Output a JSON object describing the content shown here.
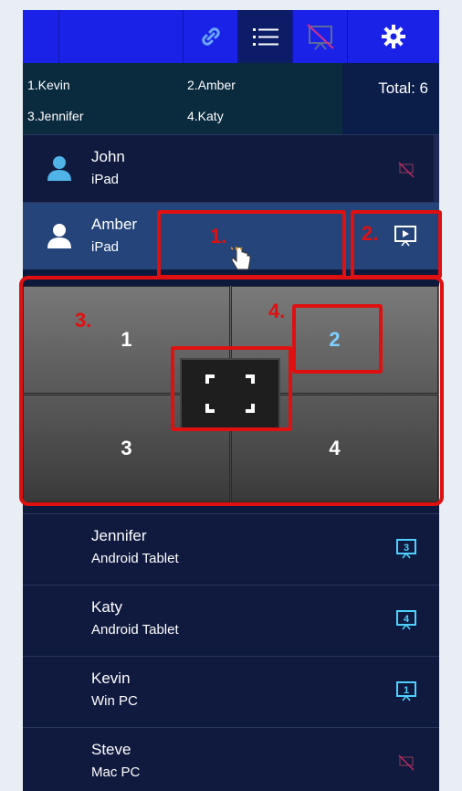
{
  "toolbar": {
    "icons": [
      "link-icon",
      "list-icon",
      "presentation-off-icon",
      "gear-icon"
    ],
    "active": "list-icon"
  },
  "summary": {
    "slots": [
      "1.Kevin",
      "2.Amber",
      "3.Jennifer",
      "4.Katy"
    ],
    "total": "Total: 6"
  },
  "users": [
    {
      "name": "John",
      "device": "iPad",
      "status": "presentation-off-icon"
    },
    {
      "name": "Amber",
      "device": "iPad",
      "status": "present-play-icon",
      "selected": true
    },
    {
      "name": "Jennifer",
      "device": "Android Tablet",
      "status": "screen-3-icon"
    },
    {
      "name": "Katy",
      "device": "Android Tablet",
      "status": "screen-4-icon"
    },
    {
      "name": "Kevin",
      "device": "Win PC",
      "status": "screen-1-icon"
    },
    {
      "name": "Steve",
      "device": "Mac PC",
      "status": "presentation-off-icon"
    }
  ],
  "split": {
    "quadrants": [
      "1",
      "2",
      "3",
      "4"
    ]
  },
  "annotations": [
    "1.",
    "2.",
    "3.",
    "4."
  ],
  "colors": {
    "toolbar": "#1b22e8",
    "selected_row": "#24447a",
    "annotation": "#e01010",
    "accent_quadrant": "#7fd0ff"
  }
}
